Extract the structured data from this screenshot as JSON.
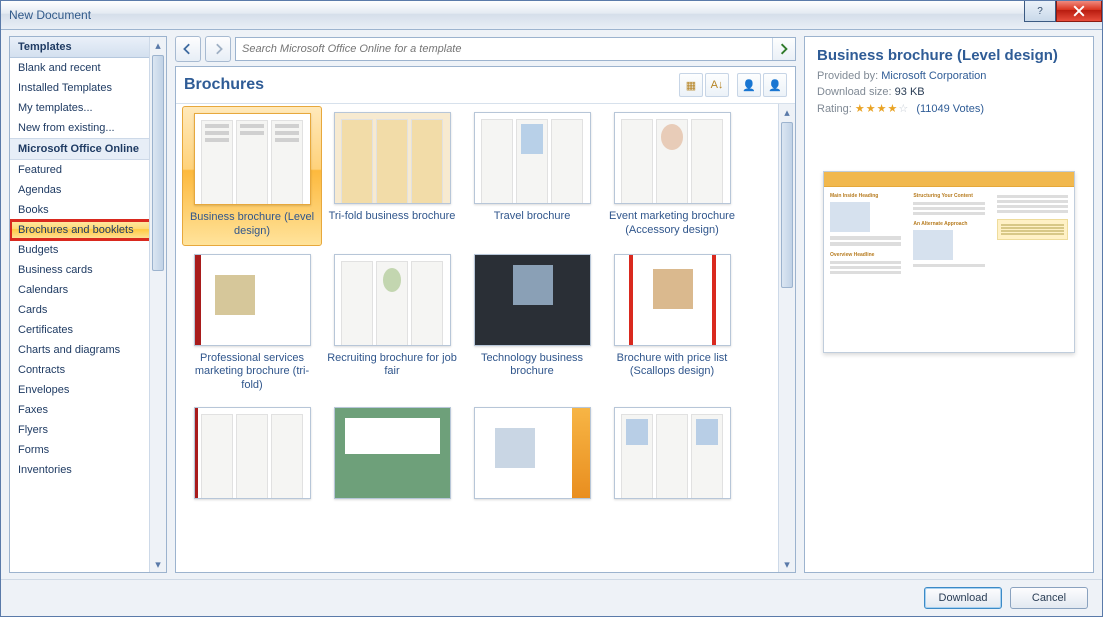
{
  "window": {
    "title": "New Document"
  },
  "sidebar": {
    "header": "Templates",
    "subheader": "Microsoft Office Online",
    "top_items": [
      "Blank and recent",
      "Installed Templates",
      "My templates...",
      "New from existing..."
    ],
    "online_items": [
      "Featured",
      "Agendas",
      "Books",
      "Brochures and booklets",
      "Budgets",
      "Business cards",
      "Calendars",
      "Cards",
      "Certificates",
      "Charts and diagrams",
      "Contracts",
      "Envelopes",
      "Faxes",
      "Flyers",
      "Forms",
      "Inventories"
    ],
    "selected_index": 3,
    "highlight_index": 3
  },
  "search": {
    "placeholder": "Search Microsoft Office Online for a template"
  },
  "content": {
    "title": "Brochures"
  },
  "templates": [
    {
      "label": "Business brochure (Level design)"
    },
    {
      "label": "Tri-fold business brochure"
    },
    {
      "label": "Travel brochure"
    },
    {
      "label": "Event marketing brochure (Accessory design)"
    },
    {
      "label": "Professional services marketing brochure (tri-fold)"
    },
    {
      "label": "Recruiting brochure for job fair"
    },
    {
      "label": "Technology business brochure"
    },
    {
      "label": "Brochure with price list (Scallops design)"
    },
    {
      "label": ""
    },
    {
      "label": ""
    },
    {
      "label": ""
    },
    {
      "label": ""
    }
  ],
  "selected_template": 0,
  "preview": {
    "title": "Business brochure (Level design)",
    "provided_label": "Provided by:",
    "provider": "Microsoft Corporation",
    "size_label": "Download size:",
    "size": "93 KB",
    "rating_label": "Rating:",
    "rating_stars": 4,
    "rating_max": 5,
    "votes": "(11049 Votes)"
  },
  "footer": {
    "download": "Download",
    "cancel": "Cancel"
  }
}
